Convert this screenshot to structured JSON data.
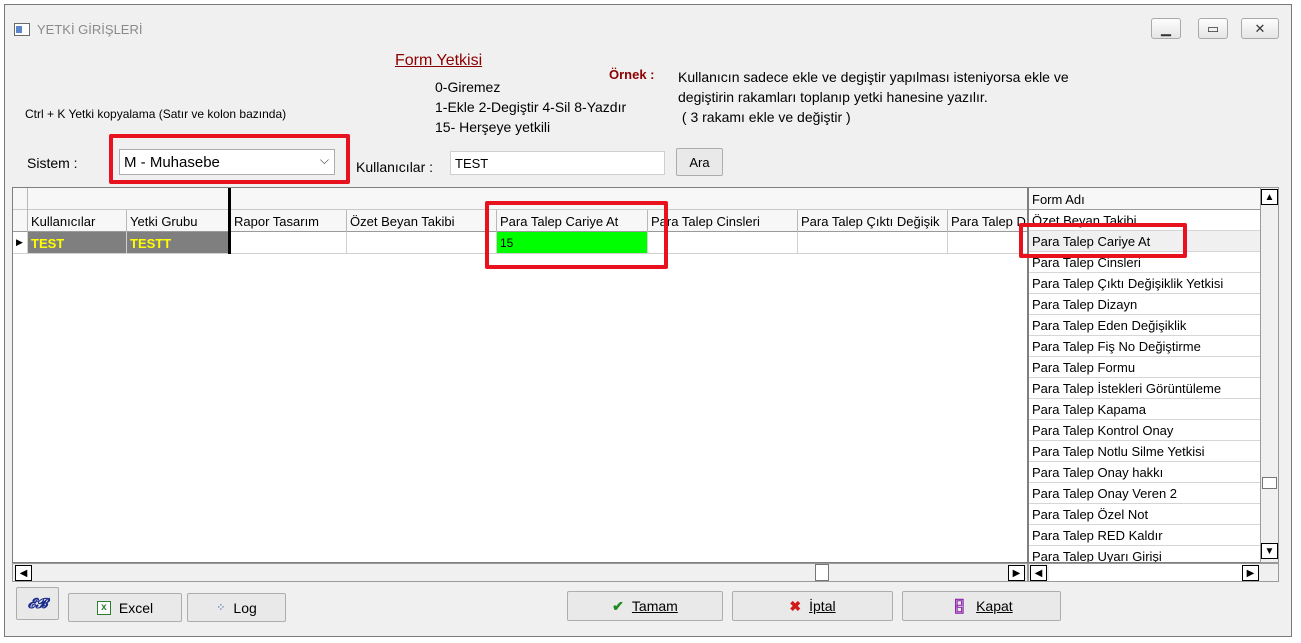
{
  "window": {
    "title": "YETKİ GİRİŞLERİ",
    "min": "▁",
    "max": "▭",
    "close": "✕"
  },
  "info": {
    "heading": "Form Yetkisi",
    "line1": "0-Giremez",
    "line2": "1-Ekle  2-Degiştir  4-Sil  8-Yazdır",
    "line3": "15- Herşeye yetkili",
    "example_label": "Örnek :",
    "example1": "Kullanıcın sadece ekle ve degiştir yapılması isteniyorsa  ekle ve",
    "example2": "degiştirin rakamları toplanıp yetki hanesine yazılır.",
    "example3": " ( 3 rakamı ekle ve değiştir )",
    "hint": "Ctrl + K Yetki kopyalama (Satır ve kolon bazında)"
  },
  "filters": {
    "sistem_label": "Sistem :",
    "sistem_value": "M - Muhasebe",
    "kullanicilar_label": "Kullanıcılar :",
    "kullanicilar_value": "TEST",
    "ara_label": "Ara"
  },
  "grid": {
    "columns": [
      "Kullanıcılar",
      "Yetki Grubu",
      "Rapor Tasarım",
      "Özet Beyan Takibi",
      "Para Talep Cariye At",
      "Para Talep Cinsleri",
      "Para Talep Çıktı Değişik",
      "Para Talep D"
    ],
    "rows": [
      [
        "TEST",
        "TESTT",
        "",
        "",
        "15",
        "",
        "",
        ""
      ]
    ],
    "indicator": "▶"
  },
  "formlist": {
    "header": "Form Adı",
    "items": [
      "Özet Beyan Takibi",
      "Para Talep Cariye At",
      "Para Talep Cinsleri",
      "Para Talep Çıktı Değişiklik Yetkisi",
      "Para Talep Dizayn",
      "Para Talep Eden Değişiklik",
      "Para Talep Fiş No Değiştirme",
      "Para Talep Formu",
      "Para Talep İstekleri Görüntüleme",
      "Para Talep Kapama",
      "Para Talep Kontrol Onay",
      "Para Talep Notlu Silme Yetkisi",
      "Para Talep Onay hakkı",
      "Para Talep Onay Veren 2",
      "Para Talep Özel Not",
      "Para Talep RED Kaldır",
      "Para Talep Uyarı Girişi"
    ]
  },
  "buttons": {
    "excel": "Excel",
    "log": "Log",
    "tamam": "Tamam",
    "iptal": "İptal",
    "kapat": "Kapat"
  },
  "colors": {
    "highlight_red": "#e8121f",
    "cell_green": "#00ff00",
    "cell_gray": "#7f7f7f",
    "cell_yellow_text": "#ffff00",
    "heading_red": "#8b0000"
  }
}
